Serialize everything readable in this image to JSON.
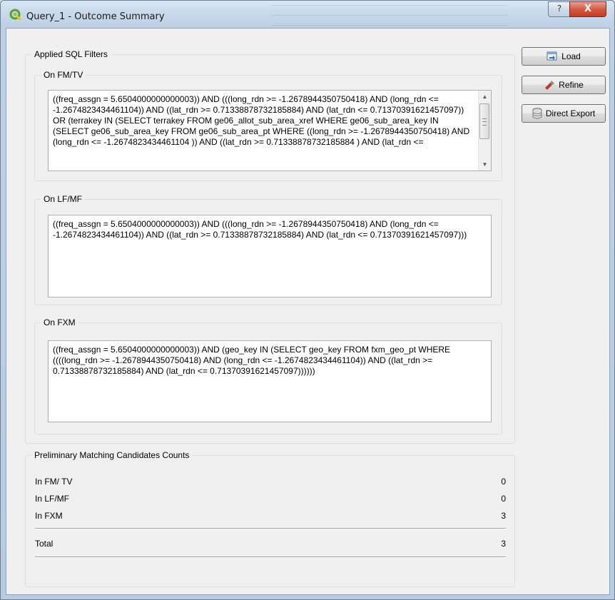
{
  "window": {
    "title": "Query_1 - Outcome Summary",
    "help_label": "?",
    "close_label": "X",
    "accent": "#c53a25"
  },
  "filters": {
    "title": "Applied SQL Filters",
    "fmtv": {
      "title": "On FM/TV",
      "text": "((freq_assgn = 5.6504000000000003)) AND (((long_rdn >= -1.2678944350750418) AND (long_rdn <= -1.2674823434461104)) AND ((lat_rdn >= 0.71338878732185884) AND (lat_rdn <= 0.71370391621457097)) OR (terrakey IN (SELECT terrakey FROM ge06_allot_sub_area_xref WHERE ge06_sub_area_key IN (SELECT ge06_sub_area_key FROM ge06_sub_area_pt WHERE ((long_rdn >= -1.2678944350750418) AND (long_rdn <= -1.2674823434461104 )) AND ((lat_rdn >= 0.71338878732185884 ) AND (lat_rdn <="
    },
    "lfmf": {
      "title": "On LF/MF",
      "text": "((freq_assgn = 5.6504000000000003)) AND (((long_rdn >= -1.2678944350750418) AND (long_rdn <= -1.2674823434461104)) AND ((lat_rdn >= 0.71338878732185884) AND (lat_rdn <= 0.71370391621457097)))"
    },
    "fxm": {
      "title": "On FXM",
      "text": "((freq_assgn = 5.6504000000000003)) AND (geo_key IN (SELECT geo_key FROM fxm_geo_pt WHERE ((((long_rdn >= -1.2678944350750418) AND (long_rdn <= -1.2674823434461104)) AND ((lat_rdn >= 0.71338878732185884) AND (lat_rdn <= 0.71370391621457097))))))"
    }
  },
  "buttons": {
    "load": "Load",
    "refine": "Refine",
    "direct_export": "Direct Export"
  },
  "counts": {
    "title": "Preliminary Matching Candidates Counts",
    "rows": [
      {
        "label": "In FM/ TV",
        "value": "0"
      },
      {
        "label": "In LF/MF",
        "value": "0"
      },
      {
        "label": "In FXM",
        "value": "3"
      }
    ],
    "total": {
      "label": "Total",
      "value": "3"
    }
  }
}
